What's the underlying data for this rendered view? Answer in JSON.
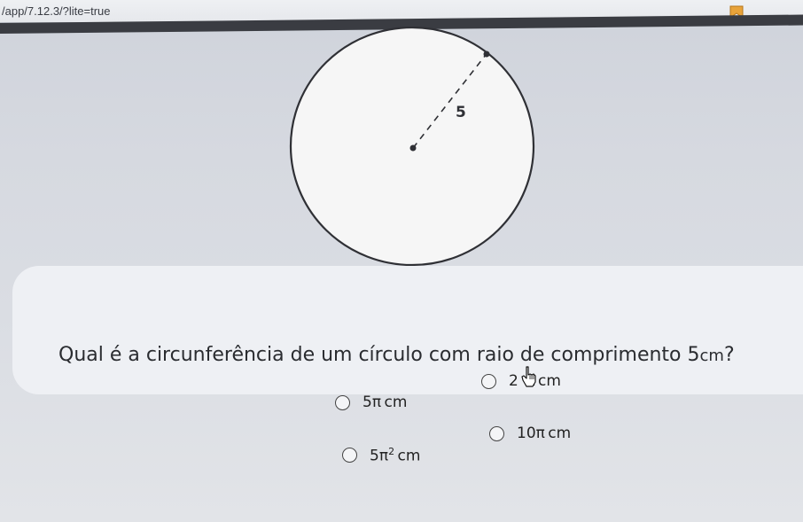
{
  "browser": {
    "url": "/app/7.12.3/?lite=true"
  },
  "figure": {
    "radius_label": "5"
  },
  "question": {
    "text": "Qual é a circunferência de um círculo com raio de comprimento ",
    "value": "5",
    "unit": "cm",
    "end": "?"
  },
  "options": [
    {
      "coef": "5",
      "pi": "π",
      "exp": "",
      "unit": "cm"
    },
    {
      "coef": "2",
      "pi": "π",
      "exp": "",
      "unit": "cm"
    },
    {
      "coef": "5",
      "pi": "π",
      "exp": "2",
      "unit": "cm"
    },
    {
      "coef": "10",
      "pi": "π",
      "exp": "",
      "unit": "cm"
    }
  ],
  "colors": {
    "background": "#d6d9e0",
    "circle_fill": "#f6f6f6",
    "circle_stroke": "#2f3035",
    "card": "#eef0f4",
    "text": "#2a2c30"
  },
  "icons": {
    "bookmark": "bookmark-icon",
    "cursor": "hand-pointer-icon"
  }
}
